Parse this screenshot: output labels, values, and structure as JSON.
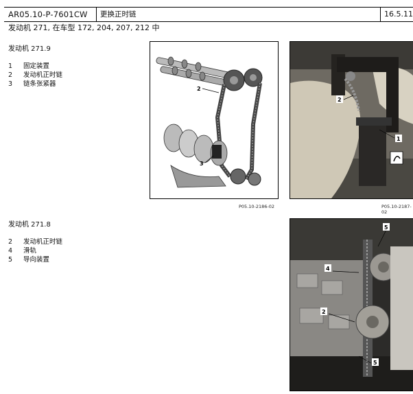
{
  "header": {
    "code": "AR05.10-P-7601CW",
    "title": "更换正时链",
    "date": "16.5.11"
  },
  "subtitle": "发动机 271, 在车型 172, 204, 207, 212 中",
  "section1": {
    "heading": "发动机 271.9",
    "items": [
      {
        "num": "1",
        "label": "固定装置"
      },
      {
        "num": "2",
        "label": "发动机正时链"
      },
      {
        "num": "3",
        "label": "链条张紧器"
      }
    ]
  },
  "section2": {
    "heading": "发动机 271.8",
    "items": [
      {
        "num": "2",
        "label": "发动机正时链"
      },
      {
        "num": "4",
        "label": "滑轨"
      },
      {
        "num": "5",
        "label": "导向装置"
      }
    ]
  },
  "figures": {
    "fig1": {
      "id": "P05.10-2186-02",
      "callouts": [
        "2",
        "3"
      ]
    },
    "fig2": {
      "id": "P05.10-2187-02",
      "callouts": [
        "2",
        "1"
      ]
    },
    "fig3": {
      "callouts": [
        "5",
        "4",
        "2",
        "5"
      ]
    }
  }
}
